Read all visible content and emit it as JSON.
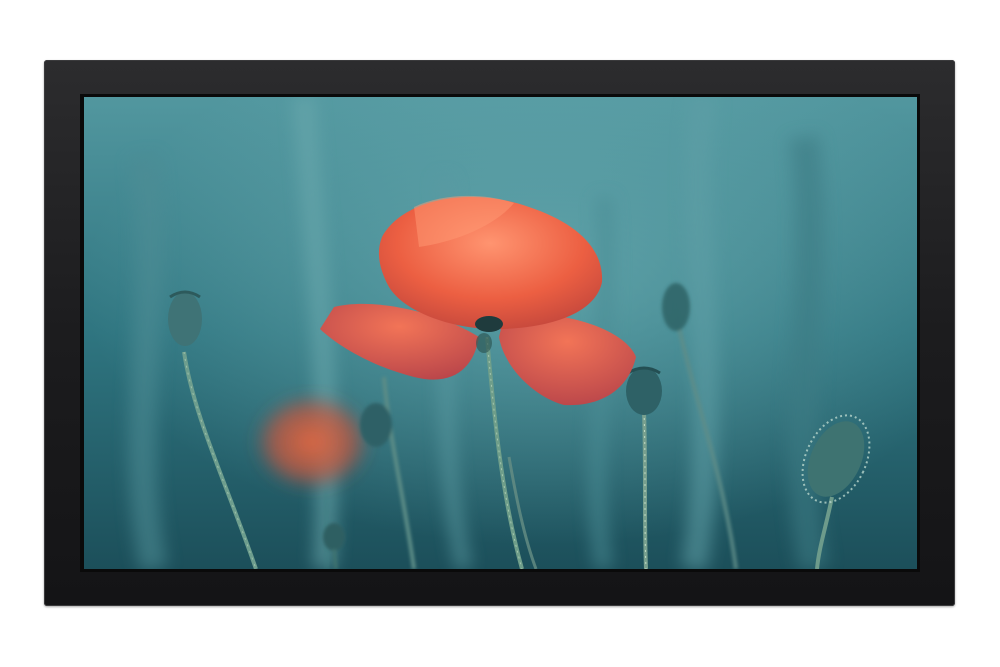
{
  "product": {
    "type": "display-monitor",
    "bezel_color": "#1e1e20"
  },
  "screen_image": {
    "subject": "poppy-flower-icon",
    "palette": {
      "background_top": "#4a8f99",
      "background_bottom": "#1f5560",
      "petal": "#f06a4a",
      "petal_shadow": "#c8453a",
      "stem": "#5f8d86",
      "bud": "#3d6f6e"
    }
  }
}
